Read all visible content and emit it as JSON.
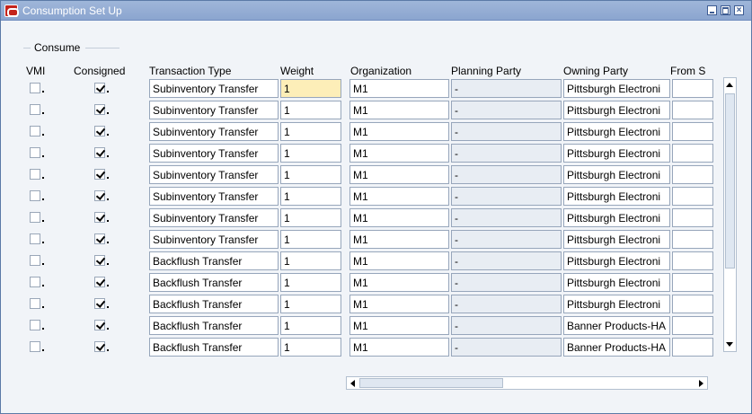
{
  "window": {
    "title": "Consumption Set Up"
  },
  "group": {
    "label": "Consume"
  },
  "columns": {
    "vmi": "VMI",
    "consigned": "Consigned",
    "transaction_type": "Transaction Type",
    "weight": "Weight",
    "organization": "Organization",
    "planning_party": "Planning Party",
    "owning_party": "Owning Party",
    "from": "From S"
  },
  "rows": [
    {
      "vmi": false,
      "consigned": true,
      "transaction_type": "Subinventory Transfer",
      "weight": "1",
      "organization": "M1",
      "planning_party": "-",
      "owning_party": "Pittsburgh Electroni",
      "from": ""
    },
    {
      "vmi": false,
      "consigned": true,
      "transaction_type": "Subinventory Transfer",
      "weight": "1",
      "organization": "M1",
      "planning_party": "-",
      "owning_party": "Pittsburgh Electroni",
      "from": ""
    },
    {
      "vmi": false,
      "consigned": true,
      "transaction_type": "Subinventory Transfer",
      "weight": "1",
      "organization": "M1",
      "planning_party": "-",
      "owning_party": "Pittsburgh Electroni",
      "from": ""
    },
    {
      "vmi": false,
      "consigned": true,
      "transaction_type": "Subinventory Transfer",
      "weight": "1",
      "organization": "M1",
      "planning_party": "-",
      "owning_party": "Pittsburgh Electroni",
      "from": ""
    },
    {
      "vmi": false,
      "consigned": true,
      "transaction_type": "Subinventory Transfer",
      "weight": "1",
      "organization": "M1",
      "planning_party": "-",
      "owning_party": "Pittsburgh Electroni",
      "from": ""
    },
    {
      "vmi": false,
      "consigned": true,
      "transaction_type": "Subinventory Transfer",
      "weight": "1",
      "organization": "M1",
      "planning_party": "-",
      "owning_party": "Pittsburgh Electroni",
      "from": ""
    },
    {
      "vmi": false,
      "consigned": true,
      "transaction_type": "Subinventory Transfer",
      "weight": "1",
      "organization": "M1",
      "planning_party": "-",
      "owning_party": "Pittsburgh Electroni",
      "from": ""
    },
    {
      "vmi": false,
      "consigned": true,
      "transaction_type": "Subinventory Transfer",
      "weight": "1",
      "organization": "M1",
      "planning_party": "-",
      "owning_party": "Pittsburgh Electroni",
      "from": ""
    },
    {
      "vmi": false,
      "consigned": true,
      "transaction_type": "Backflush Transfer",
      "weight": "1",
      "organization": "M1",
      "planning_party": "-",
      "owning_party": "Pittsburgh Electroni",
      "from": ""
    },
    {
      "vmi": false,
      "consigned": true,
      "transaction_type": "Backflush Transfer",
      "weight": "1",
      "organization": "M1",
      "planning_party": "-",
      "owning_party": "Pittsburgh Electroni",
      "from": ""
    },
    {
      "vmi": false,
      "consigned": true,
      "transaction_type": "Backflush Transfer",
      "weight": "1",
      "organization": "M1",
      "planning_party": "-",
      "owning_party": "Pittsburgh Electroni",
      "from": ""
    },
    {
      "vmi": false,
      "consigned": true,
      "transaction_type": "Backflush Transfer",
      "weight": "1",
      "organization": "M1",
      "planning_party": "-",
      "owning_party": "Banner Products-HA",
      "from": ""
    },
    {
      "vmi": false,
      "consigned": true,
      "transaction_type": "Backflush Transfer",
      "weight": "1",
      "organization": "M1",
      "planning_party": "-",
      "owning_party": "Banner Products-HA",
      "from": ""
    }
  ],
  "colors": {
    "title_bar": "#8ba5cf",
    "focused_field": "#fdeeb8",
    "readonly_field": "#e8edf3",
    "brand_red": "#c4241c"
  }
}
